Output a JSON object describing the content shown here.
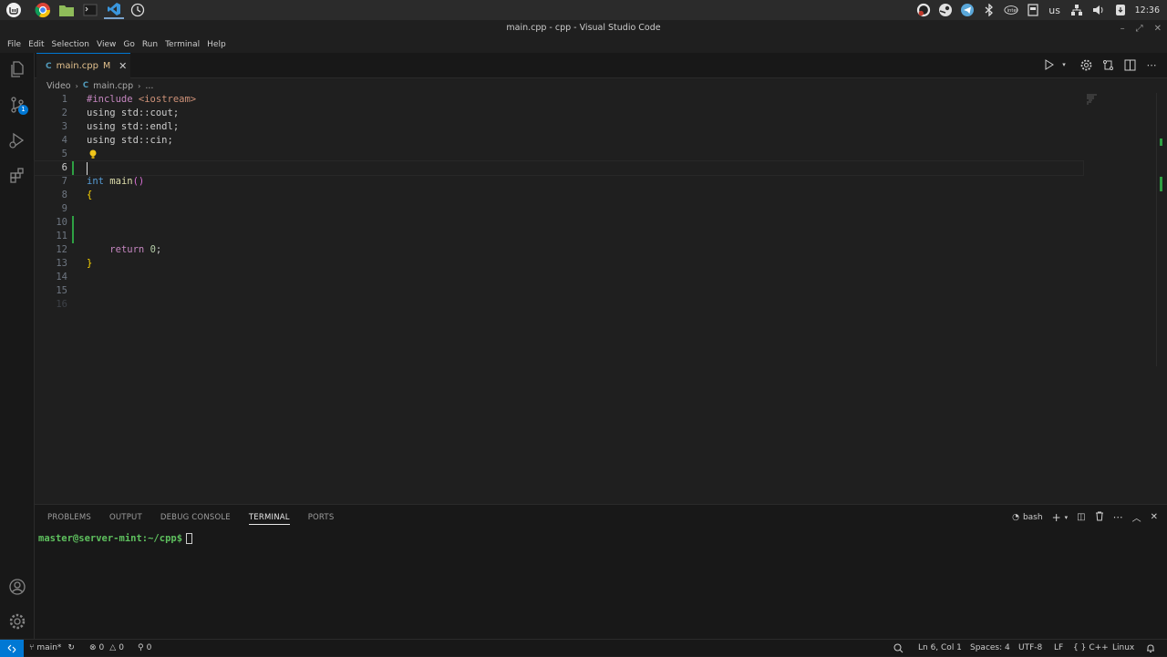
{
  "window": {
    "title": "main.cpp - cpp - Visual Studio Code"
  },
  "os_panel": {
    "keyboard_layout": "us",
    "clock": "12:36"
  },
  "menu": [
    "File",
    "Edit",
    "Selection",
    "View",
    "Go",
    "Run",
    "Terminal",
    "Help"
  ],
  "tab": {
    "label": "main.cpp",
    "status": "M"
  },
  "breadcrumb": {
    "folder": "Video",
    "file": "main.cpp",
    "more": "..."
  },
  "activity": {
    "scm_badge": "1"
  },
  "editor": {
    "lines": [
      {
        "n": "1",
        "text": "#include <iostream>"
      },
      {
        "n": "2",
        "text": "using std::cout;"
      },
      {
        "n": "3",
        "text": "using std::endl;"
      },
      {
        "n": "4",
        "text": "using std::cin;"
      },
      {
        "n": "5",
        "text": ""
      },
      {
        "n": "6",
        "text": ""
      },
      {
        "n": "7",
        "text": "int main()"
      },
      {
        "n": "8",
        "text": "{"
      },
      {
        "n": "9",
        "text": ""
      },
      {
        "n": "10",
        "text": ""
      },
      {
        "n": "11",
        "text": ""
      },
      {
        "n": "12",
        "text": "    return 0;"
      },
      {
        "n": "13",
        "text": "}"
      },
      {
        "n": "14",
        "text": ""
      },
      {
        "n": "15",
        "text": ""
      },
      {
        "n": "16",
        "text": ""
      }
    ]
  },
  "panel": {
    "tabs": [
      "PROBLEMS",
      "OUTPUT",
      "DEBUG CONSOLE",
      "TERMINAL",
      "PORTS"
    ],
    "active_tab": "TERMINAL",
    "shell": "bash",
    "prompt": "master@server-mint:~/cpp$"
  },
  "status": {
    "branch": "main*",
    "errors": "0",
    "warnings": "0",
    "ports": "0",
    "position": "Ln 6, Col 1",
    "spaces": "Spaces: 4",
    "encoding": "UTF-8",
    "eol": "LF",
    "language": "C++",
    "platform": "Linux"
  },
  "colors": {
    "accent": "#0078d4",
    "modified": "#e2c08d",
    "added_gutter": "#2ea043"
  }
}
